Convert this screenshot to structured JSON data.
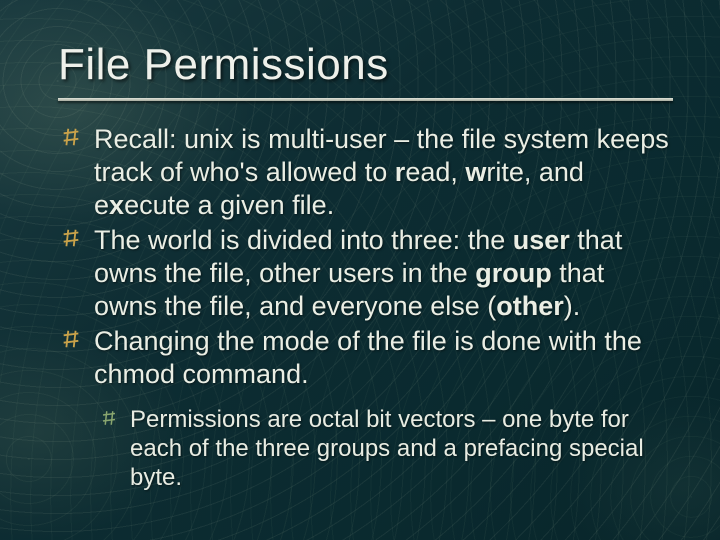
{
  "title": "File Permissions",
  "bullets": [
    {
      "html": "Recall: unix is multi-user – the file system keeps track of who's allowed to <b>r</b>ead, <b>w</b>rite, and e<b>x</b>ecute a given file."
    },
    {
      "html": "The world is divided into three: the <b>user</b> that owns the file, other users in the <b>group</b> that owns the file, and everyone else (<b>other</b>)."
    },
    {
      "html": "Changing the mode of the file is done with the chmod command."
    }
  ],
  "sub_bullets": [
    {
      "html": "Permissions are octal bit vectors – one byte for each of the three groups and a prefacing special byte."
    }
  ]
}
